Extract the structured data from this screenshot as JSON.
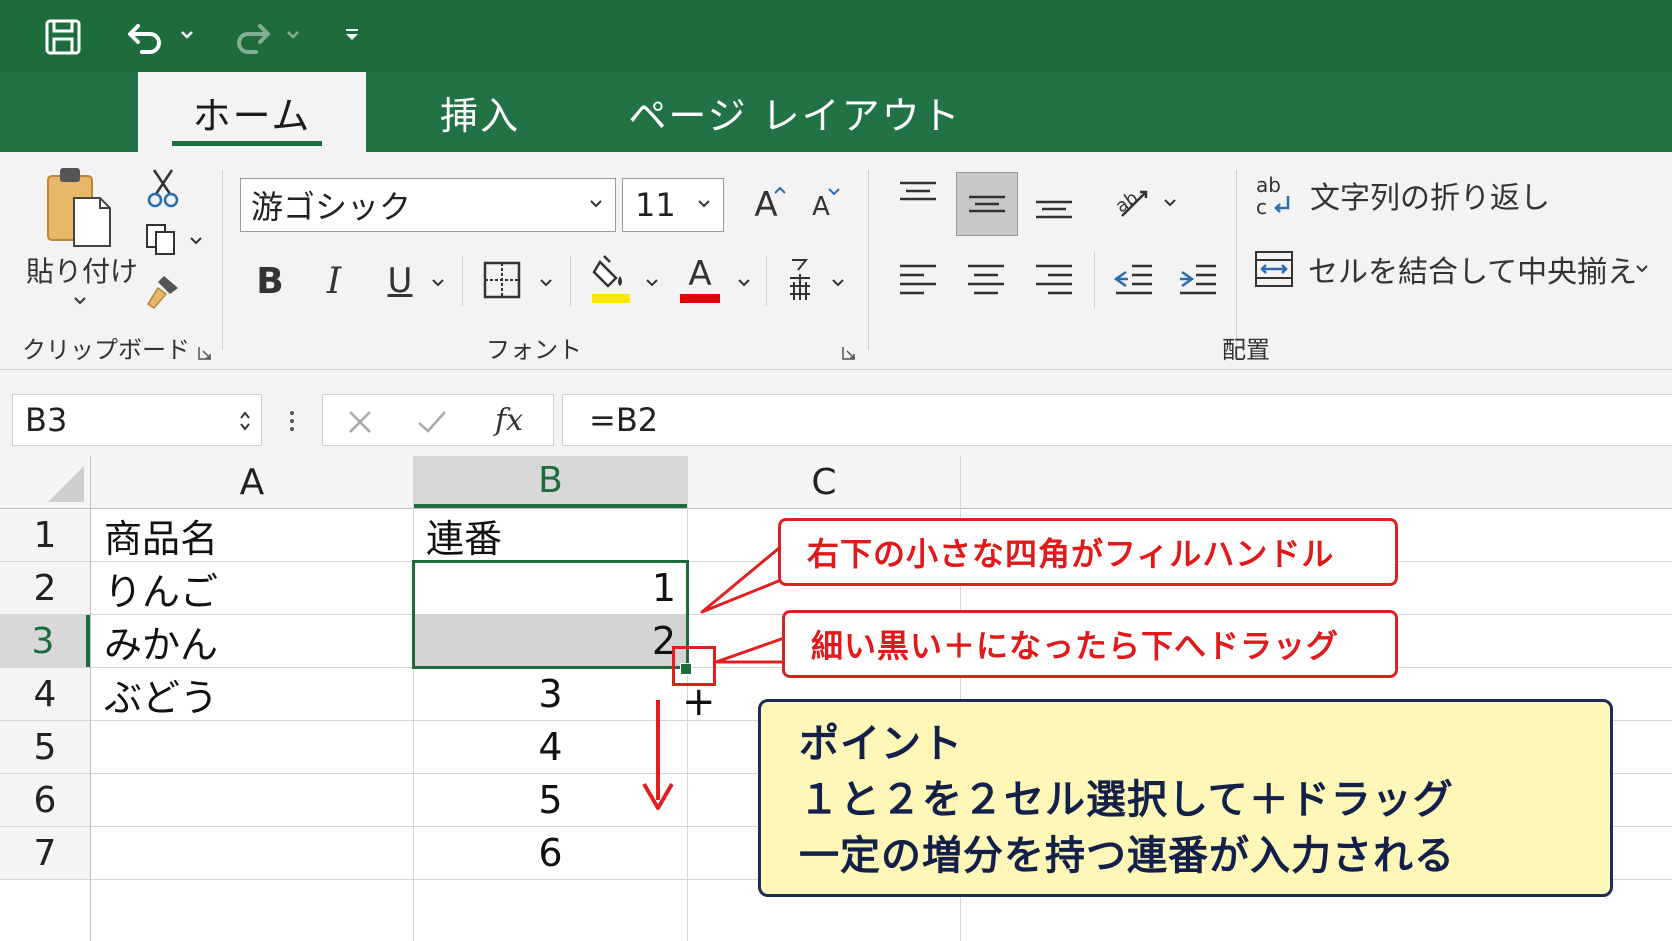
{
  "tabs": [
    {
      "label": "ホーム",
      "active": true
    },
    {
      "label": "挿入",
      "active": false
    },
    {
      "label": "ページ レイアウト",
      "active": false
    }
  ],
  "ribbon": {
    "clipboard": {
      "paste_label": "貼り付け",
      "group_label": "クリップボード"
    },
    "font": {
      "font_name": "游ゴシック",
      "font_size": "11",
      "bold": "B",
      "italic": "I",
      "underline": "U",
      "font_color_glyph": "A",
      "grow_glyph": "A",
      "shrink_glyph": "A",
      "group_label": "フォント"
    },
    "alignment": {
      "wrap_text_label": "文字列の折り返し",
      "merge_label": "セルを結合して中央揃え",
      "group_label": "配置"
    }
  },
  "formula_bar": {
    "name_box": "B3",
    "fx": "fx",
    "formula": "=B2"
  },
  "sheet": {
    "columns": [
      "A",
      "B",
      "C"
    ],
    "rows": [
      "1",
      "2",
      "3",
      "4",
      "5",
      "6",
      "7"
    ],
    "cells": {
      "A1": "商品名",
      "B1": "連番",
      "A2": "りんご",
      "B2": "1",
      "A3": "みかん",
      "B3": "2",
      "A4": "ぶどう",
      "B4": "3",
      "B5": "4",
      "B6": "5",
      "B7": "6"
    },
    "selected_column": "B",
    "selected_row": "3"
  },
  "annotations": {
    "callout1": "右下の小さな四角がフィルハンドル",
    "callout2": "細い黒い＋になったら下へドラッグ",
    "point_title": "ポイント",
    "point_line1": "１と２を２セル選択して＋ドラッグ",
    "point_line2": "一定の増分を持つ連番が入力される",
    "plus_glyph": "+"
  },
  "colors": {
    "title_bar": "#1e6b3c",
    "tab_bar": "#217346",
    "accent_red": "#e02020",
    "point_bg": "#fff7b8",
    "point_border": "#1b2b5c",
    "selection_green": "#1e6b3c"
  }
}
